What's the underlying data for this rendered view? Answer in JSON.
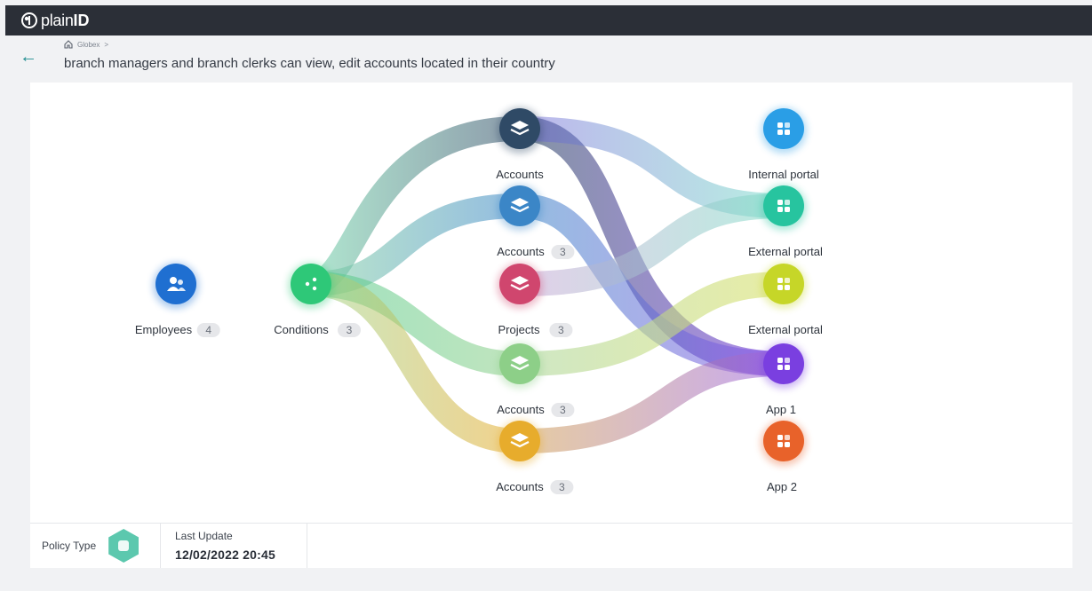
{
  "brand": {
    "logo_light": "plain",
    "logo_bold": "ID"
  },
  "breadcrumb": {
    "root": "Globex",
    "separator": ">"
  },
  "page_title": "branch managers and branch clerks can view, edit accounts located in their country",
  "graph": {
    "nodes": {
      "employees": {
        "label": "Employees",
        "count": "4",
        "color": "#1f6fd1",
        "icon": "users-icon"
      },
      "conditions": {
        "label": "Conditions",
        "count": "3",
        "color": "#2ec878",
        "icon": "share-icon"
      },
      "accounts1": {
        "label": "Accounts",
        "count": "",
        "color": "#2f4a66",
        "icon": "layers-icon"
      },
      "accounts2": {
        "label": "Accounts",
        "count": "3",
        "color": "#3b86c7",
        "icon": "layers-icon"
      },
      "projects": {
        "label": "Projects",
        "count": "3",
        "color": "#d0466e",
        "icon": "layers-icon"
      },
      "accounts3": {
        "label": "Accounts",
        "count": "3",
        "color": "#8dcf88",
        "icon": "layers-icon"
      },
      "accounts4": {
        "label": "Accounts",
        "count": "3",
        "color": "#e7ac2c",
        "icon": "layers-icon"
      },
      "internal_portal": {
        "label": "Internal portal",
        "count": "",
        "color": "#2a9ee6",
        "icon": "apps-icon"
      },
      "external_portal1": {
        "label": "External portal",
        "count": "",
        "color": "#27c49f",
        "icon": "apps-icon"
      },
      "external_portal2": {
        "label": "External portal",
        "count": "",
        "color": "#c6d628",
        "icon": "apps-icon"
      },
      "app1": {
        "label": "App 1",
        "count": "",
        "color": "#7a3fe0",
        "icon": "apps-icon"
      },
      "app2": {
        "label": "App 2",
        "count": "",
        "color": "#e8622a",
        "icon": "apps-icon"
      }
    }
  },
  "footer": {
    "policy_type_label": "Policy Type",
    "policy_type_icon": "policy-hex-icon",
    "last_update_label": "Last Update",
    "last_update_value": "12/02/2022  20:45"
  }
}
